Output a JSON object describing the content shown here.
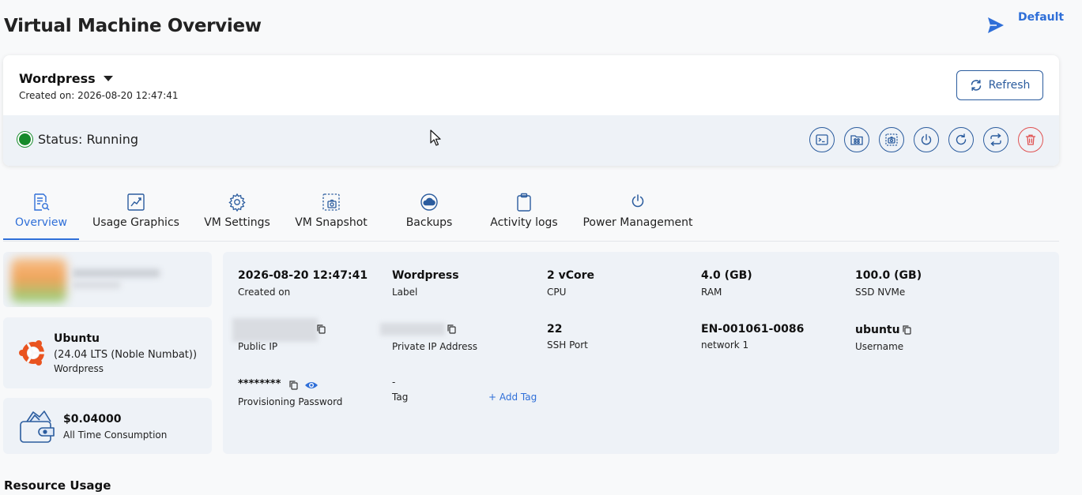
{
  "page": {
    "title": "Virtual Machine Overview"
  },
  "workspace": {
    "label": "Default"
  },
  "vm": {
    "name": "Wordpress",
    "created_on": "Created on: 2026-08-20 12:47:41",
    "refresh_label": "Refresh",
    "status": "Status: Running",
    "status_color": "#168a2a",
    "actions": [
      "console-icon",
      "apps-icon",
      "snapshot-icon",
      "power-icon",
      "restart-icon",
      "reinstall-icon",
      "delete-icon"
    ]
  },
  "tabs": [
    {
      "label": "Overview",
      "icon": "document-search-icon",
      "active": true
    },
    {
      "label": "Usage Graphics",
      "icon": "chart-icon"
    },
    {
      "label": "VM Settings",
      "icon": "gear-icon"
    },
    {
      "label": "VM Snapshot",
      "icon": "snapshot-icon"
    },
    {
      "label": "Backups",
      "icon": "cloud-backup-icon"
    },
    {
      "label": "Activity logs",
      "icon": "clipboard-icon"
    },
    {
      "label": "Power Management",
      "icon": "power-icon"
    }
  ],
  "os": {
    "name": "Ubuntu",
    "version": "(24.04 LTS (Noble Numbat))",
    "app": "Wordpress"
  },
  "consumption": {
    "value": "$0.04000",
    "label": "All Time Consumption"
  },
  "details": {
    "created_value": "2026-08-20 12:47:41",
    "created_label": "Created on",
    "label_value": "Wordpress",
    "label_label": "Label",
    "cpu_value": "2 vCore",
    "cpu_label": "CPU",
    "ram_value": "4.0 (GB)",
    "ram_label": "RAM",
    "disk_value": "100.0 (GB)",
    "disk_label": "SSD NVMe",
    "public_ip_label": "Public IP",
    "private_ip_label": "Private IP Address",
    "ssh_value": "22",
    "ssh_label": "SSH Port",
    "network_value": "EN-001061-0086",
    "network_label": "network 1",
    "username_value": "ubuntu",
    "username_label": "Username",
    "password_value": "********",
    "password_label": "Provisioning Password",
    "tag_value": "-",
    "tag_label": "Tag",
    "add_tag": "+ Add Tag"
  },
  "sections": {
    "resource_usage": "Resource Usage"
  },
  "colors": {
    "accent": "#2f6fd8",
    "outline": "#2b5c9e",
    "danger": "#e05252",
    "panel": "#eef2f7"
  }
}
